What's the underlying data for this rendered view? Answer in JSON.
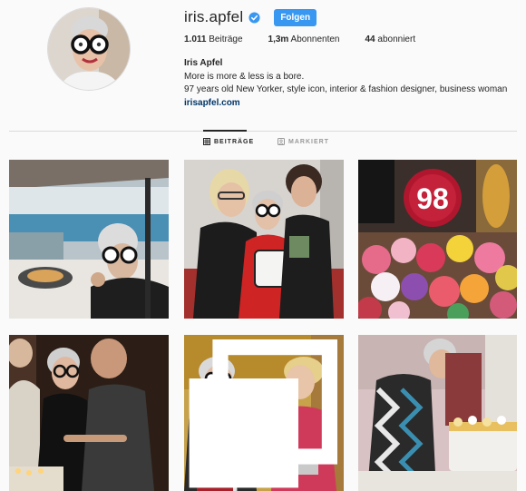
{
  "profile": {
    "username": "iris.apfel",
    "follow_label": "Folgen",
    "stats": {
      "posts_count": "1.011",
      "posts_label": "Beiträge",
      "followers_count": "1,3m",
      "followers_label": "Abonnenten",
      "following_count": "44",
      "following_label": "abonniert"
    },
    "bio": {
      "name": "Iris Apfel",
      "line1": "More is more & less is a bore.",
      "line2": "97 years old New Yorker, style icon, interior & fashion designer, business woman",
      "link": "irisapfel.com"
    }
  },
  "tabs": {
    "posts": "BEITRÄGE",
    "tagged": "MARKIERT"
  },
  "colors": {
    "follow_button": "#3897f0",
    "verified": "#3897f0",
    "link": "#003569"
  },
  "posts": {
    "cake_number": "98"
  },
  "icons": [
    "verified-badge-icon",
    "grid-icon",
    "tag-icon",
    "gallery-icon"
  ]
}
